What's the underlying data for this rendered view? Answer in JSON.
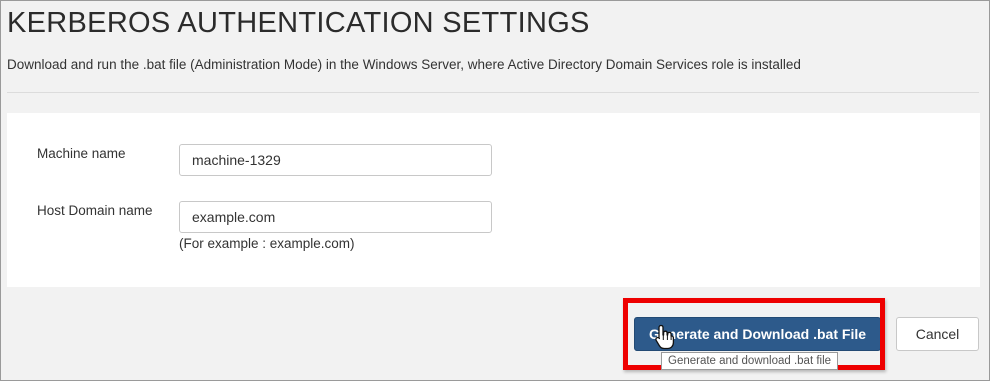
{
  "page": {
    "title": "KERBEROS AUTHENTICATION SETTINGS",
    "subtitle": "Download and run the .bat file (Administration Mode) in the Windows Server, where Active Directory Domain Services role is installed"
  },
  "form": {
    "machine_name": {
      "label": "Machine name",
      "value": "machine-1329"
    },
    "host_domain_name": {
      "label": "Host Domain name",
      "value": "example.com",
      "help": "(For example : example.com)"
    }
  },
  "actions": {
    "generate_label": "Generate and Download .bat File",
    "generate_tooltip": "Generate and download .bat file",
    "cancel_label": "Cancel"
  },
  "colors": {
    "primary_button": "#2d5a8b",
    "highlight": "#ee0000",
    "background": "#f2f2f2"
  },
  "icons": {
    "cursor": "hand-pointer-icon"
  }
}
